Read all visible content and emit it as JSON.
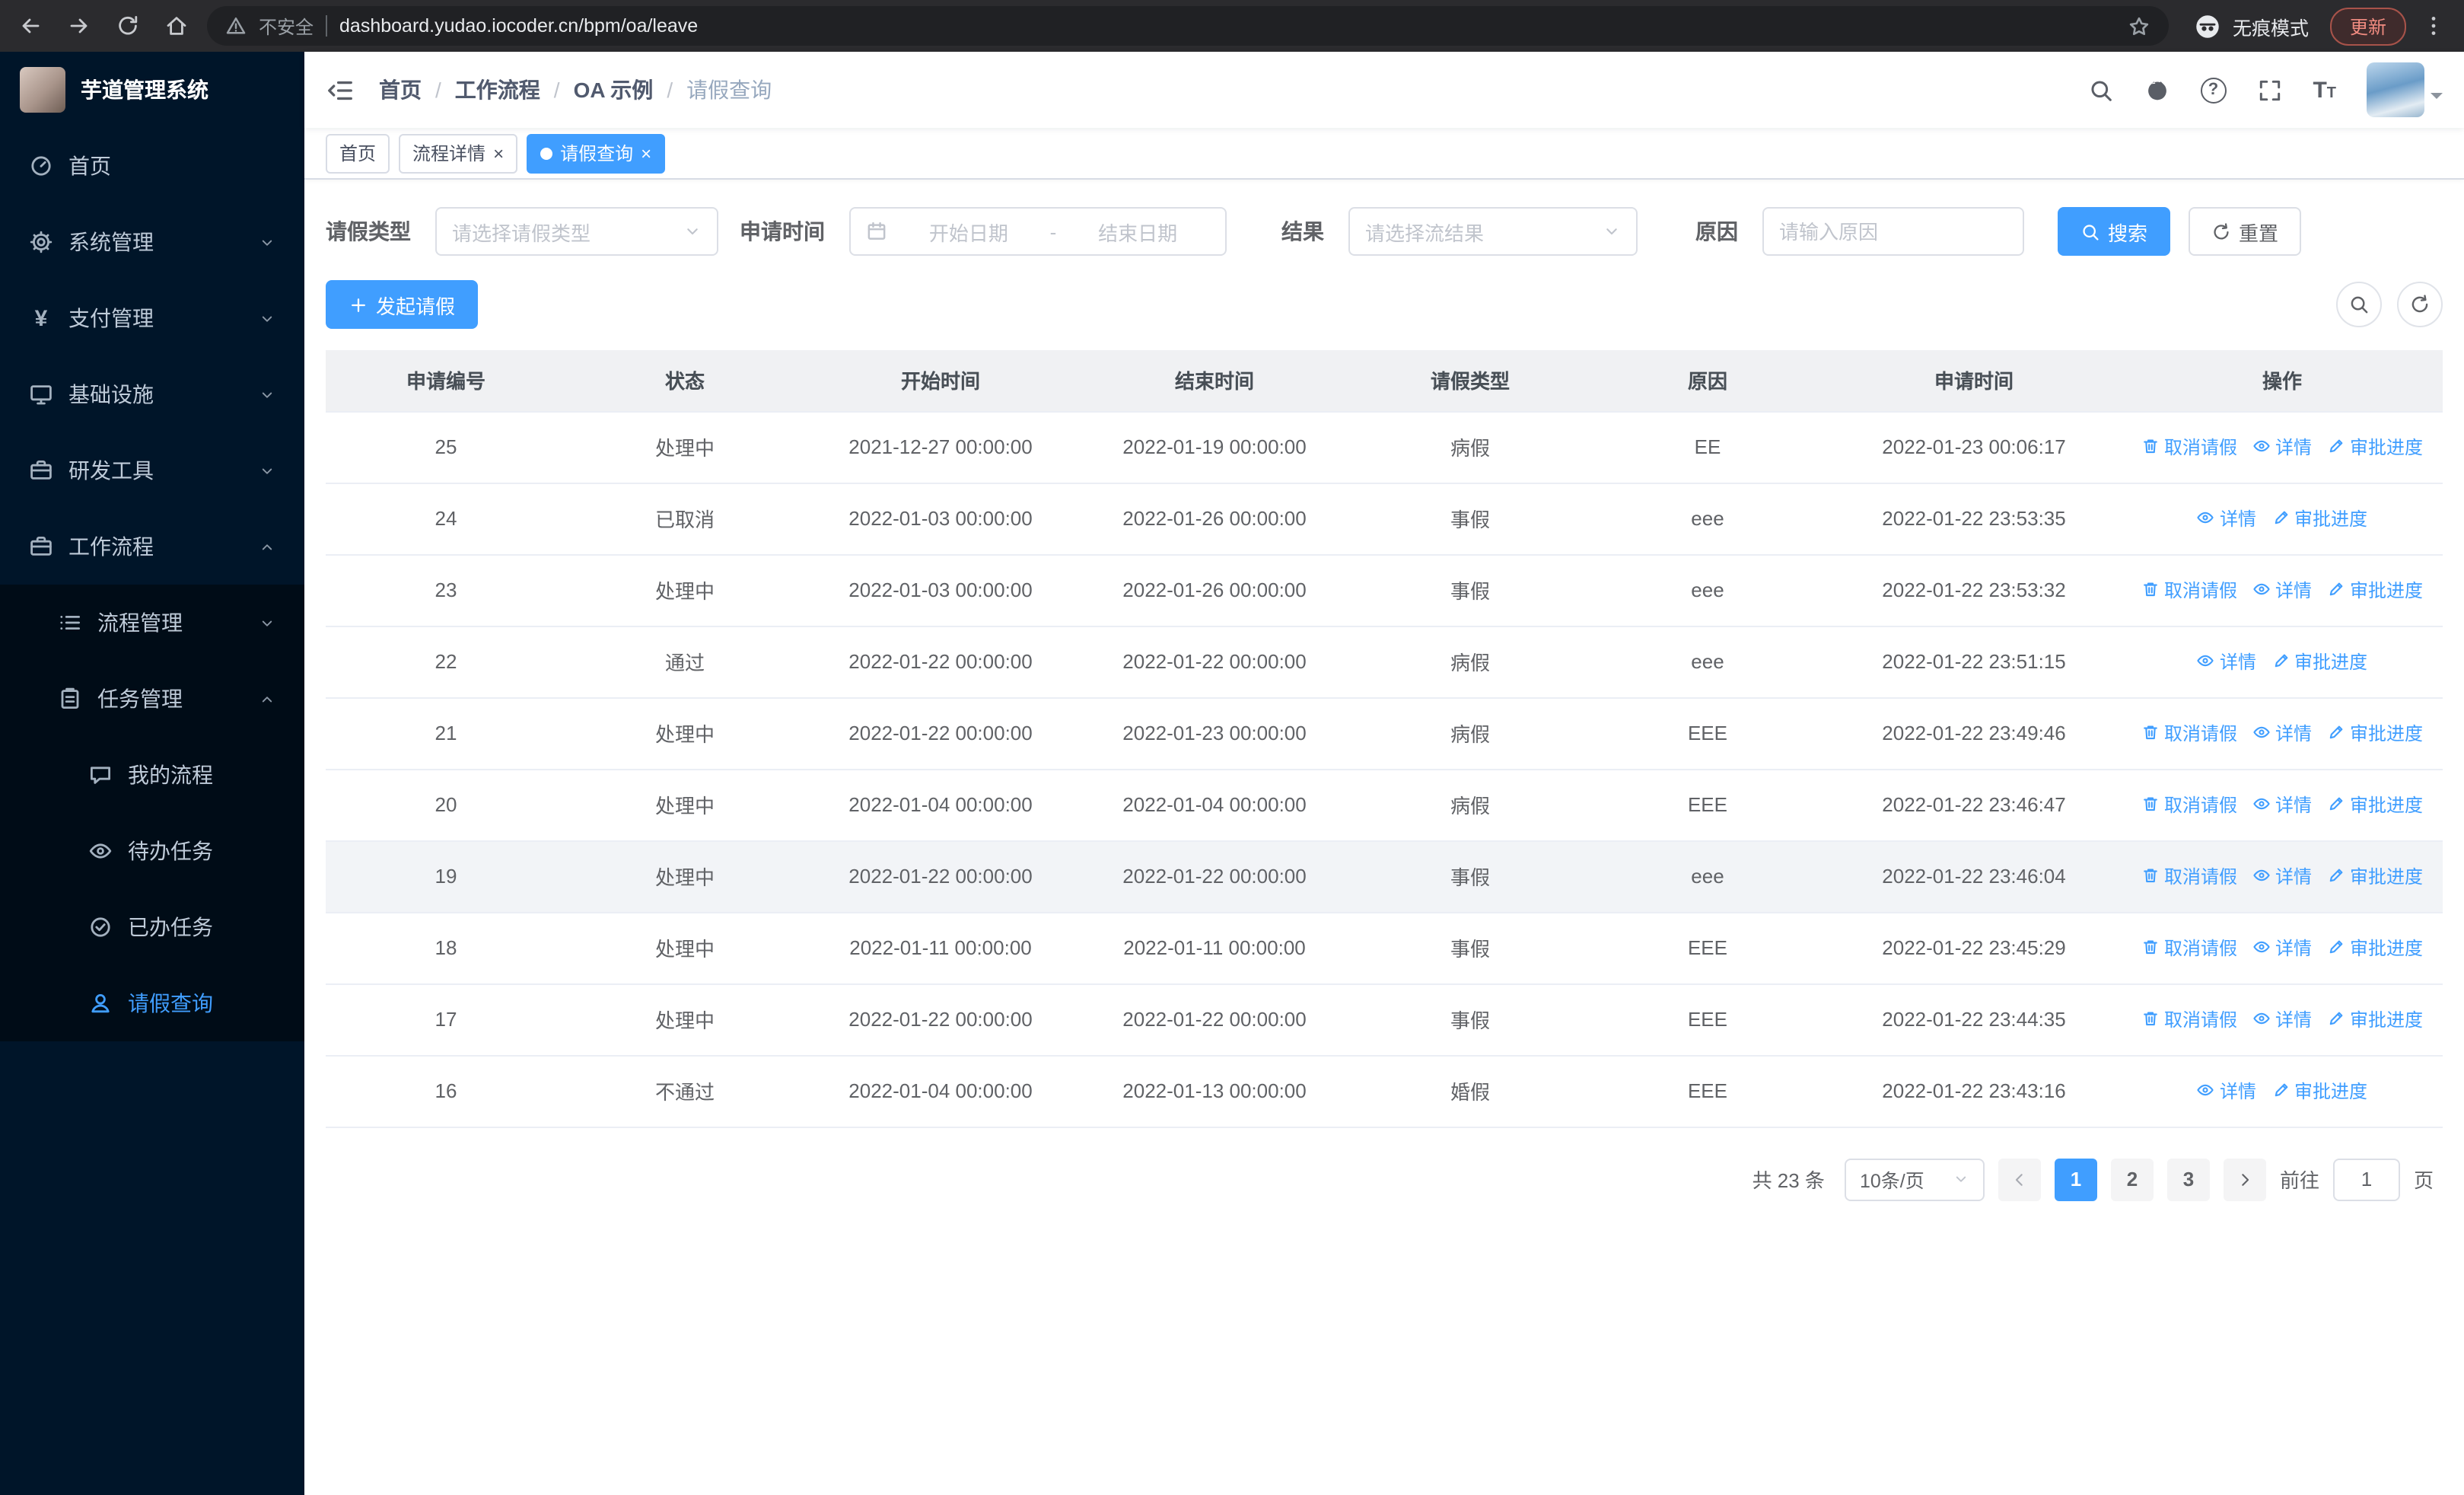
{
  "theme": {
    "primary": "#409eff",
    "sidebar_bg": "#001529",
    "sidebar_submenu_bg": "#000c17",
    "chrome_bg": "#2b2b2e",
    "table_header_bg": "#f0f1f3"
  },
  "browser": {
    "security_label": "不安全",
    "url": "dashboard.yudao.iocoder.cn/bpm/oa/leave",
    "incognito_label": "无痕模式",
    "update_label": "更新"
  },
  "sidebar": {
    "logo_title": "芋道管理系统",
    "items": {
      "home": "首页",
      "system": "系统管理",
      "payment": "支付管理",
      "infra": "基础设施",
      "devtools": "研发工具",
      "workflow": "工作流程",
      "process_mgmt": "流程管理",
      "task_mgmt": "任务管理",
      "my_process": "我的流程",
      "todo_tasks": "待办任务",
      "done_tasks": "已办任务",
      "leave_query": "请假查询"
    }
  },
  "header": {
    "breadcrumb": [
      "首页",
      "工作流程",
      "OA 示例",
      "请假查询"
    ],
    "separator": "/"
  },
  "tabs": [
    {
      "label": "首页"
    },
    {
      "label": "流程详情",
      "close": "×"
    },
    {
      "label": "请假查询",
      "close": "×",
      "active": true
    }
  ],
  "filters": {
    "leave_type_label": "请假类型",
    "leave_type_placeholder": "请选择请假类型",
    "apply_time_label": "申请时间",
    "start_date_placeholder": "开始日期",
    "date_separator": "-",
    "end_date_placeholder": "结束日期",
    "result_label": "结果",
    "result_placeholder": "请选择流结果",
    "reason_label": "原因",
    "reason_placeholder": "请输入原因",
    "search_label": "搜索",
    "reset_label": "重置"
  },
  "toolbar": {
    "create_label": "发起请假"
  },
  "table": {
    "columns": [
      "申请编号",
      "状态",
      "开始时间",
      "结束时间",
      "请假类型",
      "原因",
      "申请时间",
      "操作"
    ],
    "actions": {
      "cancel": "取消请假",
      "detail": "详情",
      "progress": "审批进度"
    },
    "action_icons": {
      "cancel": "trash",
      "detail": "eye",
      "progress": "edit"
    },
    "rows": [
      {
        "no": "25",
        "status": "处理中",
        "start": "2021-12-27 00:00:00",
        "end": "2022-01-19 00:00:00",
        "type": "病假",
        "reason": "EE",
        "applied": "2022-01-23 00:06:17",
        "cancel": true,
        "highlighted": false
      },
      {
        "no": "24",
        "status": "已取消",
        "start": "2022-01-03 00:00:00",
        "end": "2022-01-26 00:00:00",
        "type": "事假",
        "reason": "eee",
        "applied": "2022-01-22 23:53:35",
        "cancel": false,
        "highlighted": false
      },
      {
        "no": "23",
        "status": "处理中",
        "start": "2022-01-03 00:00:00",
        "end": "2022-01-26 00:00:00",
        "type": "事假",
        "reason": "eee",
        "applied": "2022-01-22 23:53:32",
        "cancel": true,
        "highlighted": false
      },
      {
        "no": "22",
        "status": "通过",
        "start": "2022-01-22 00:00:00",
        "end": "2022-01-22 00:00:00",
        "type": "病假",
        "reason": "eee",
        "applied": "2022-01-22 23:51:15",
        "cancel": false,
        "highlighted": false
      },
      {
        "no": "21",
        "status": "处理中",
        "start": "2022-01-22 00:00:00",
        "end": "2022-01-23 00:00:00",
        "type": "病假",
        "reason": "EEE",
        "applied": "2022-01-22 23:49:46",
        "cancel": true,
        "highlighted": false
      },
      {
        "no": "20",
        "status": "处理中",
        "start": "2022-01-04 00:00:00",
        "end": "2022-01-04 00:00:00",
        "type": "病假",
        "reason": "EEE",
        "applied": "2022-01-22 23:46:47",
        "cancel": true,
        "highlighted": false
      },
      {
        "no": "19",
        "status": "处理中",
        "start": "2022-01-22 00:00:00",
        "end": "2022-01-22 00:00:00",
        "type": "事假",
        "reason": "eee",
        "applied": "2022-01-22 23:46:04",
        "cancel": true,
        "highlighted": true
      },
      {
        "no": "18",
        "status": "处理中",
        "start": "2022-01-11 00:00:00",
        "end": "2022-01-11 00:00:00",
        "type": "事假",
        "reason": "EEE",
        "applied": "2022-01-22 23:45:29",
        "cancel": true,
        "highlighted": false
      },
      {
        "no": "17",
        "status": "处理中",
        "start": "2022-01-22 00:00:00",
        "end": "2022-01-22 00:00:00",
        "type": "事假",
        "reason": "EEE",
        "applied": "2022-01-22 23:44:35",
        "cancel": true,
        "highlighted": false
      },
      {
        "no": "16",
        "status": "不通过",
        "start": "2022-01-04 00:00:00",
        "end": "2022-01-13 00:00:00",
        "type": "婚假",
        "reason": "EEE",
        "applied": "2022-01-22 23:43:16",
        "cancel": false,
        "highlighted": false
      }
    ]
  },
  "pagination": {
    "total_text": "共 23 条",
    "page_size_label": "10条/页",
    "pages": [
      "1",
      "2",
      "3"
    ],
    "active_page": "1",
    "goto_label": "前往",
    "goto_value": "1",
    "goto_suffix": "页"
  }
}
